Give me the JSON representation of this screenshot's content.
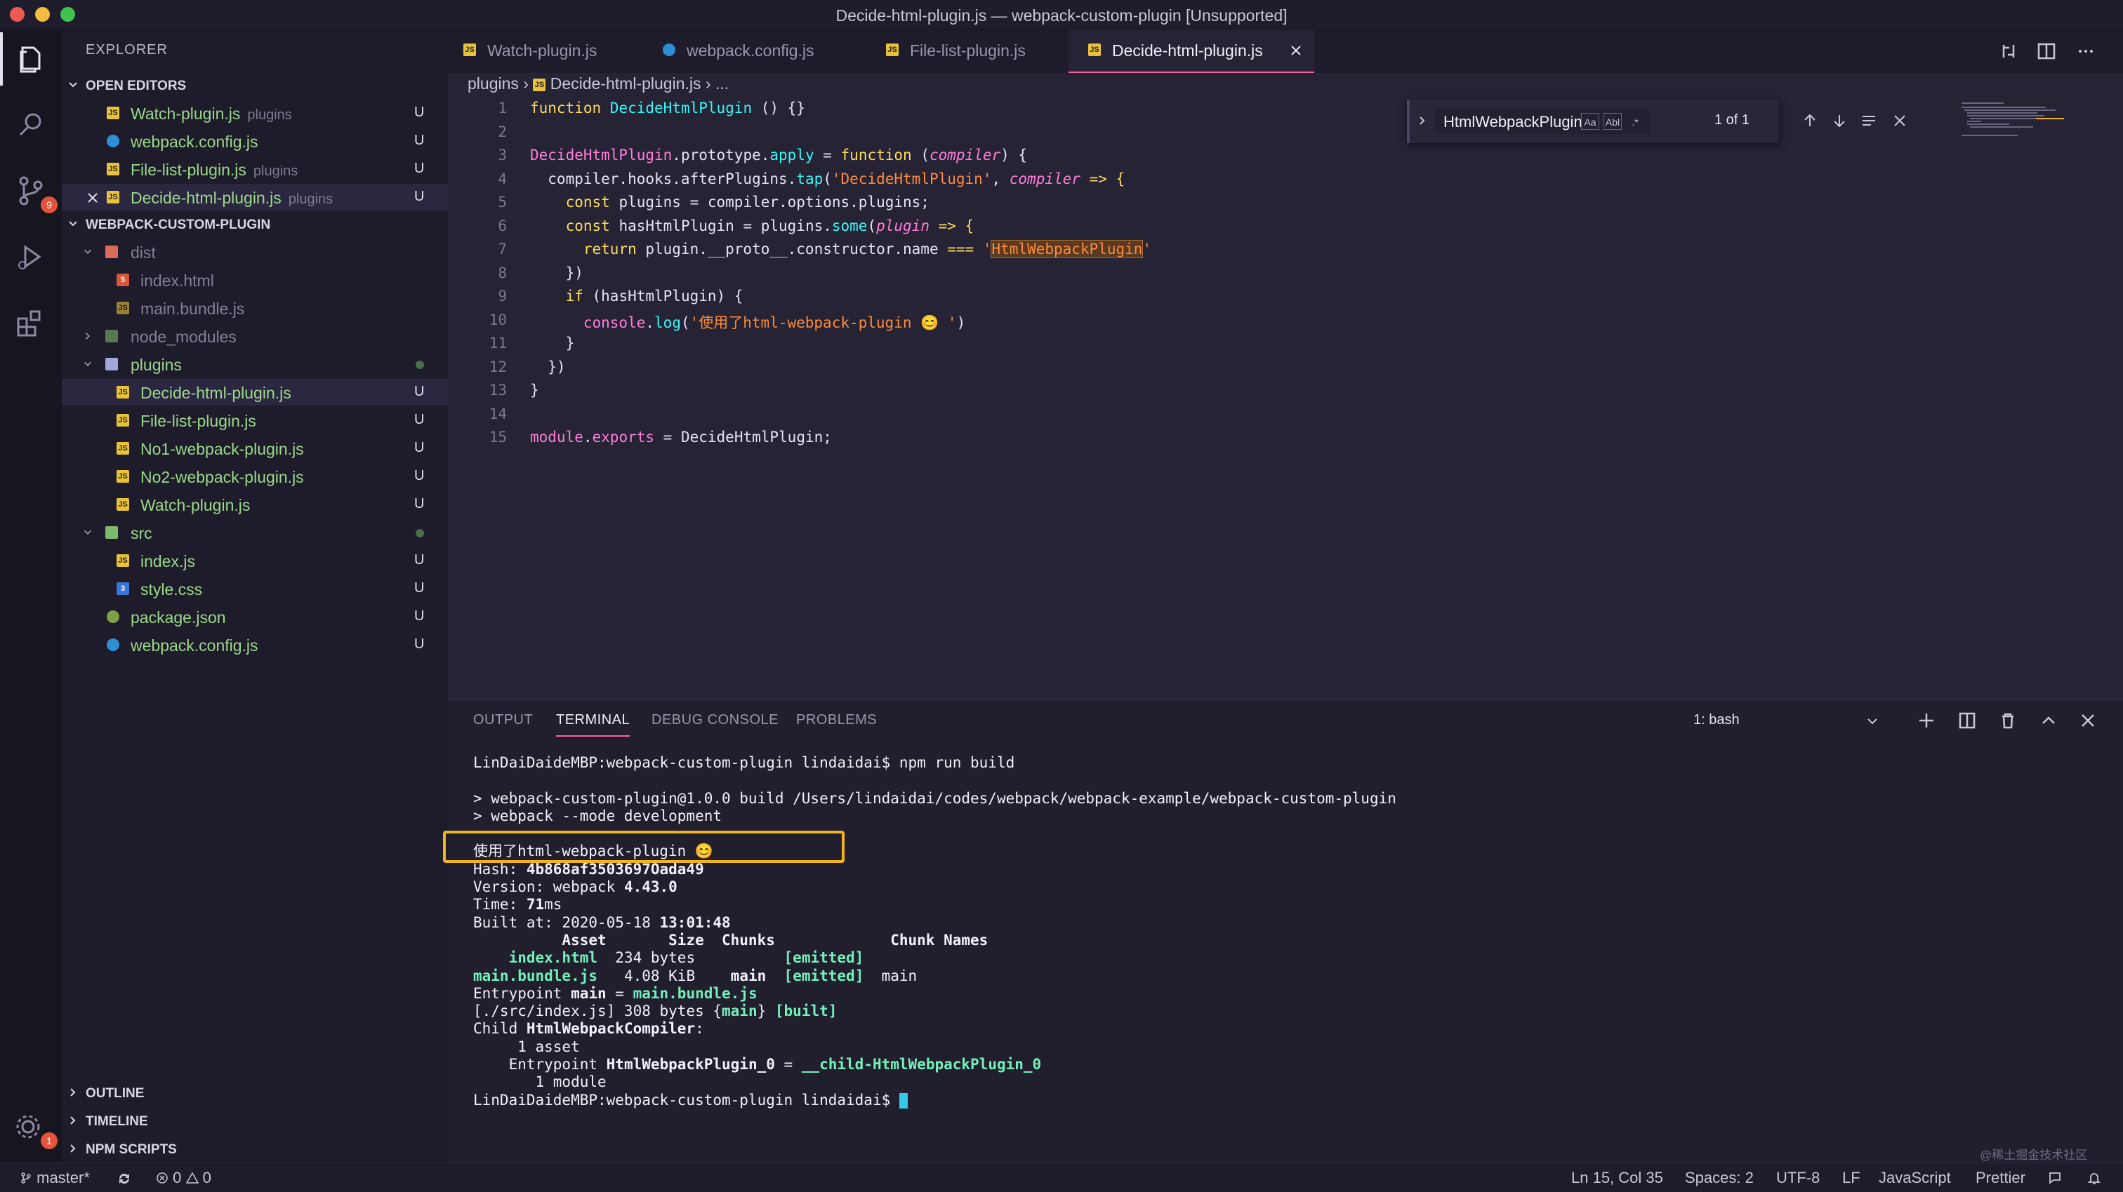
{
  "window": {
    "title": "Decide-html-plugin.js — webpack-custom-plugin [Unsupported]"
  },
  "activity": {
    "scm_badge": "9",
    "settings_badge": "1"
  },
  "sidebar": {
    "title": "EXPLORER",
    "open_editors": {
      "header": "OPEN EDITORS",
      "items": [
        {
          "name": "Watch-plugin.js",
          "folder": "plugins",
          "status": "U"
        },
        {
          "name": "webpack.config.js",
          "folder": "",
          "status": "U"
        },
        {
          "name": "File-list-plugin.js",
          "folder": "plugins",
          "status": "U"
        },
        {
          "name": "Decide-html-plugin.js",
          "folder": "plugins",
          "status": "U"
        }
      ]
    },
    "project": {
      "header": "WEBPACK-CUSTOM-PLUGIN",
      "items": [
        {
          "name": "dist",
          "type": "folder-open",
          "status": ""
        },
        {
          "name": "index.html",
          "type": "html",
          "status": ""
        },
        {
          "name": "main.bundle.js",
          "type": "js",
          "status": ""
        },
        {
          "name": "node_modules",
          "type": "folder",
          "status": ""
        },
        {
          "name": "plugins",
          "type": "folder-open",
          "status": "dot"
        },
        {
          "name": "Decide-html-plugin.js",
          "type": "js",
          "status": "U"
        },
        {
          "name": "File-list-plugin.js",
          "type": "js",
          "status": "U"
        },
        {
          "name": "No1-webpack-plugin.js",
          "type": "js",
          "status": "U"
        },
        {
          "name": "No2-webpack-plugin.js",
          "type": "js",
          "status": "U"
        },
        {
          "name": "Watch-plugin.js",
          "type": "js",
          "status": "U"
        },
        {
          "name": "src",
          "type": "folder-open",
          "status": "dot"
        },
        {
          "name": "index.js",
          "type": "js",
          "status": "U"
        },
        {
          "name": "style.css",
          "type": "css",
          "status": "U"
        },
        {
          "name": "package.json",
          "type": "json",
          "status": "U"
        },
        {
          "name": "webpack.config.js",
          "type": "config",
          "status": "U"
        }
      ]
    },
    "bottom_sections": [
      "OUTLINE",
      "TIMELINE",
      "NPM SCRIPTS"
    ]
  },
  "tabs": [
    {
      "label": "Watch-plugin.js",
      "type": "js"
    },
    {
      "label": "webpack.config.js",
      "type": "config"
    },
    {
      "label": "File-list-plugin.js",
      "type": "js"
    },
    {
      "label": "Decide-html-plugin.js",
      "type": "js",
      "active": true
    }
  ],
  "breadcrumb": {
    "folder": "plugins",
    "file": "Decide-html-plugin.js",
    "more": "..."
  },
  "find": {
    "query": "HtmlWebpackPlugin",
    "case_label": "Aa",
    "word_label": "Abl",
    "regex_label": ".*",
    "result": "1 of 1"
  },
  "editor": {
    "lines": [
      [
        {
          "t": "function ",
          "c": "kw"
        },
        {
          "t": "DecideHtmlPlugin",
          "c": "fn"
        },
        {
          "t": " () {}",
          "c": "pl"
        }
      ],
      [],
      [
        {
          "t": "DecideHtmlPlugin",
          "c": "pr"
        },
        {
          "t": ".prototype.",
          "c": "pl"
        },
        {
          "t": "apply",
          "c": "fn"
        },
        {
          "t": " = ",
          "c": "pl"
        },
        {
          "t": "function",
          "c": "kw"
        },
        {
          "t": " (",
          "c": "pl"
        },
        {
          "t": "compiler",
          "c": "pa"
        },
        {
          "t": ") {",
          "c": "pl"
        }
      ],
      [
        {
          "t": "  compiler.hooks.afterPlugins.",
          "c": "pl"
        },
        {
          "t": "tap",
          "c": "fn"
        },
        {
          "t": "(",
          "c": "pl"
        },
        {
          "t": "'DecideHtmlPlugin'",
          "c": "st"
        },
        {
          "t": ", ",
          "c": "pl"
        },
        {
          "t": "compiler",
          "c": "pa"
        },
        {
          "t": " => {",
          "c": "kw"
        }
      ],
      [
        {
          "t": "    ",
          "c": "pl"
        },
        {
          "t": "const",
          "c": "kw"
        },
        {
          "t": " plugins = compiler.options.plugins;",
          "c": "pl"
        }
      ],
      [
        {
          "t": "    ",
          "c": "pl"
        },
        {
          "t": "const",
          "c": "kw"
        },
        {
          "t": " hasHtmlPlugin = plugins.",
          "c": "pl"
        },
        {
          "t": "some",
          "c": "fn"
        },
        {
          "t": "(",
          "c": "pl"
        },
        {
          "t": "plugin",
          "c": "pa"
        },
        {
          "t": " => {",
          "c": "kw"
        }
      ],
      [
        {
          "t": "      ",
          "c": "pl"
        },
        {
          "t": "return",
          "c": "kw"
        },
        {
          "t": " plugin.__proto__.constructor.name ",
          "c": "pl"
        },
        {
          "t": "===",
          "c": "kw"
        },
        {
          "t": " ",
          "c": "pl"
        },
        {
          "t": "'",
          "c": "st"
        },
        {
          "t": "HtmlWebpackPlugin",
          "c": "st hl"
        },
        {
          "t": "'",
          "c": "st"
        }
      ],
      [
        {
          "t": "    })",
          "c": "pl"
        }
      ],
      [
        {
          "t": "    ",
          "c": "pl"
        },
        {
          "t": "if",
          "c": "kw"
        },
        {
          "t": " (hasHtmlPlugin) {",
          "c": "pl"
        }
      ],
      [
        {
          "t": "      ",
          "c": "pl"
        },
        {
          "t": "console",
          "c": "pr"
        },
        {
          "t": ".",
          "c": "pl"
        },
        {
          "t": "log",
          "c": "fn"
        },
        {
          "t": "(",
          "c": "pl"
        },
        {
          "t": "'使用了html-webpack-plugin 😊 '",
          "c": "st"
        },
        {
          "t": ")",
          "c": "pl"
        }
      ],
      [
        {
          "t": "    }",
          "c": "pl"
        }
      ],
      [
        {
          "t": "  })",
          "c": "pl"
        }
      ],
      [
        {
          "t": "}",
          "c": "pl"
        }
      ],
      [],
      [
        {
          "t": "module",
          "c": "pr"
        },
        {
          "t": ".",
          "c": "pl"
        },
        {
          "t": "exports",
          "c": "pr"
        },
        {
          "t": " = ",
          "c": "pl"
        },
        {
          "t": "DecideHtmlPlugin",
          "c": "pl"
        },
        {
          "t": ";",
          "c": "pl"
        }
      ]
    ]
  },
  "panel": {
    "tabs": [
      "OUTPUT",
      "TERMINAL",
      "DEBUG CONSOLE",
      "PROBLEMS"
    ],
    "active_tab": "TERMINAL",
    "terminal_select": "1: bash",
    "terminal_lines": [
      [
        {
          "t": "LinDaiDaideMBP:webpack-custom-plugin lindaidai$ npm run build"
        }
      ],
      [],
      [
        {
          "t": "> webpack-custom-plugin@1.0.0 build /Users/lindaidai/codes/webpack/webpack-example/webpack-custom-plugin"
        }
      ],
      [
        {
          "t": "> webpack --mode development"
        }
      ],
      [],
      [
        {
          "t": "使用了html-webpack-plugin 😊"
        }
      ],
      [
        {
          "t": "Hash: "
        },
        {
          "t": "4b868af3503697Oada49",
          "c": "b"
        }
      ],
      [
        {
          "t": "Version: webpack "
        },
        {
          "t": "4.43.0",
          "c": "b"
        }
      ],
      [
        {
          "t": "Time: "
        },
        {
          "t": "71",
          "c": "b"
        },
        {
          "t": "ms"
        }
      ],
      [
        {
          "t": "Built at: 2020-05-18 "
        },
        {
          "t": "13:01:48",
          "c": "b"
        }
      ],
      [
        {
          "t": "          Asset       Size  Chunks             Chunk Names",
          "c": "b"
        }
      ],
      [
        {
          "t": "    "
        },
        {
          "t": "index.html",
          "c": "tg"
        },
        {
          "t": "  234 bytes          "
        },
        {
          "t": "[emitted]",
          "c": "tg"
        }
      ],
      [
        {
          "t": "main.bundle.js",
          "c": "tg"
        },
        {
          "t": "   4.08 KiB    "
        },
        {
          "t": "main",
          "c": "b"
        },
        {
          "t": "  "
        },
        {
          "t": "[emitted]",
          "c": "tg"
        },
        {
          "t": "  main"
        }
      ],
      [
        {
          "t": "Entrypoint "
        },
        {
          "t": "main",
          "c": "b"
        },
        {
          "t": " = "
        },
        {
          "t": "main.bundle.js",
          "c": "tg"
        }
      ],
      [
        {
          "t": "[./src/index.js] 308 bytes {"
        },
        {
          "t": "main",
          "c": "tg"
        },
        {
          "t": "} "
        },
        {
          "t": "[built]",
          "c": "tg"
        }
      ],
      [
        {
          "t": "Child "
        },
        {
          "t": "HtmlWebpackCompiler",
          "c": "b"
        },
        {
          "t": ":"
        }
      ],
      [
        {
          "t": "     1 asset"
        }
      ],
      [
        {
          "t": "    Entrypoint "
        },
        {
          "t": "HtmlWebpackPlugin_0",
          "c": "b"
        },
        {
          "t": " = "
        },
        {
          "t": "__child-HtmlWebpackPlugin_0",
          "c": "tg"
        }
      ],
      [
        {
          "t": "       1 module"
        }
      ],
      [
        {
          "t": "LinDaiDaideMBP:webpack-custom-plugin lindaidai$ "
        },
        {
          "t": "",
          "c": "cursor"
        }
      ]
    ]
  },
  "statusbar": {
    "branch": "master*",
    "errors": "0",
    "warnings": "0",
    "position": "Ln 15, Col 35",
    "spaces": "Spaces: 2",
    "encoding": "UTF-8",
    "eol": "LF",
    "language": "JavaScript",
    "formatter": "Prettier"
  },
  "watermark": "@稀土掘金技术社区",
  "colors": {
    "accent": "#ff5fa2",
    "highlight_box": "#f2b41c",
    "background": "#262335"
  }
}
